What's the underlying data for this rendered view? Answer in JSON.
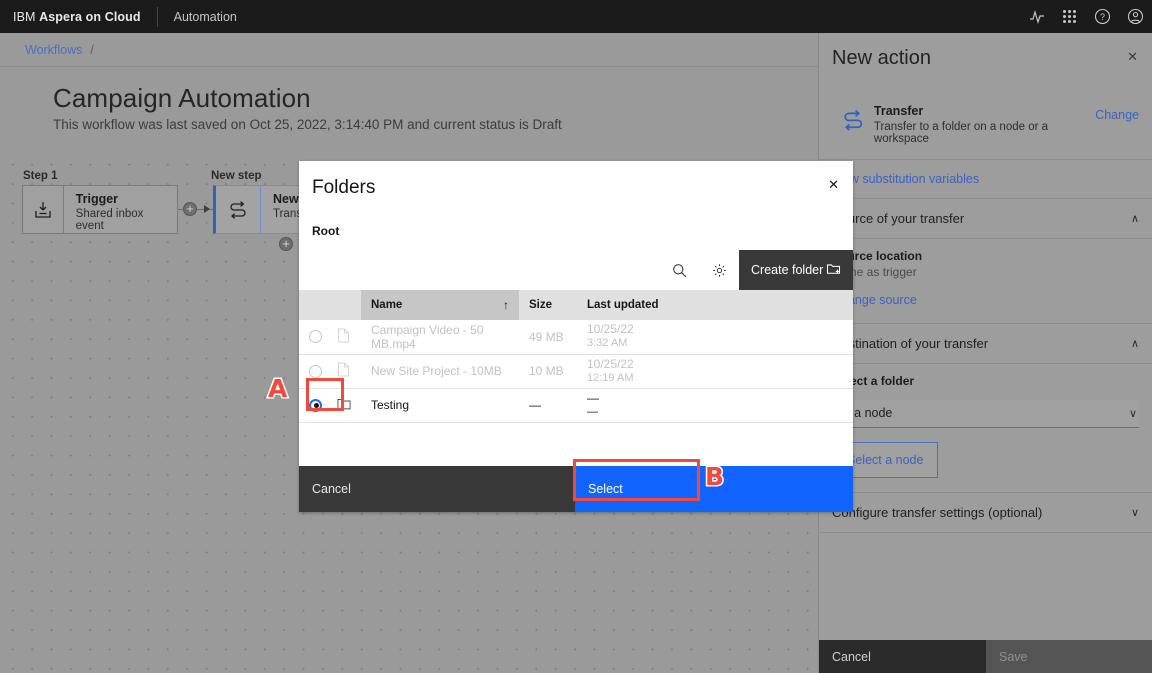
{
  "topbar": {
    "brand_prefix": "IBM ",
    "brand_name": "Aspera on Cloud",
    "app": "Automation",
    "icons": [
      "activity-icon",
      "app-switcher-icon",
      "help-icon",
      "account-icon"
    ]
  },
  "breadcrumb": {
    "link": "Workflows",
    "separator": "/"
  },
  "page": {
    "title": "Campaign Automation",
    "subtitle": "This workflow was last saved on Oct 25, 2022, 3:14:40 PM and current status is Draft"
  },
  "canvas": {
    "step1_label": "Step 1",
    "newstep_label": "New step",
    "nodes": [
      {
        "title": "Trigger",
        "desc": "Shared inbox event",
        "icon": "inbox-download-icon"
      },
      {
        "title": "New action",
        "desc": "Transfer",
        "icon": "transfer-arrows-icon"
      }
    ],
    "add_button": "+"
  },
  "panel": {
    "title": "New action",
    "close": "✕",
    "action": {
      "name": "Transfer",
      "desc": "Transfer to a folder on a node or a workspace",
      "change_label": "Change",
      "icon": "transfer-arrows-icon"
    },
    "substitution_link": "View substitution variables",
    "source_section": {
      "heading": "Source of your transfer",
      "chevron": "∧",
      "field_label": "Source location",
      "field_value": "Same as trigger",
      "change_link": "Change source"
    },
    "destination_section": {
      "heading": "Destination of your transfer",
      "chevron": "∧",
      "field_label": "Select a folder",
      "dropdown_value": "On a node",
      "dropdown_chevron": "∨",
      "select_node_button": "Select a node"
    },
    "settings_section": {
      "heading": "Configure transfer settings (optional)",
      "chevron": "∨"
    },
    "cancel_label": "Cancel",
    "save_label": "Save"
  },
  "modal": {
    "title": "Folders",
    "close": "✕",
    "root_label": "Root",
    "toolbar": {
      "search_icon": "search-icon",
      "settings_icon": "gear-icon",
      "create_folder_label": "Create folder",
      "create_folder_icon": "folder-add-icon"
    },
    "table": {
      "columns": [
        "",
        "",
        "Name",
        "Size",
        "Last updated"
      ],
      "sorted_column": "Name",
      "sort_direction": "↑",
      "rows": [
        {
          "selected": false,
          "disabled": true,
          "icon": "file-icon",
          "name": "Campaign Video - 50 MB.mp4",
          "size": "49 MB",
          "updated_date": "10/25/22",
          "updated_time": "3:32 AM"
        },
        {
          "selected": false,
          "disabled": true,
          "icon": "file-icon",
          "name": "New Site Project - 10MB",
          "size": "10 MB",
          "updated_date": "10/25/22",
          "updated_time": "12:19 AM"
        },
        {
          "selected": true,
          "disabled": false,
          "icon": "folder-icon",
          "name": "Testing",
          "size": "—",
          "updated_date": "—",
          "updated_time": "—"
        }
      ]
    },
    "cancel_label": "Cancel",
    "select_label": "Select"
  },
  "annotations": {
    "a": "A",
    "b": "B"
  }
}
